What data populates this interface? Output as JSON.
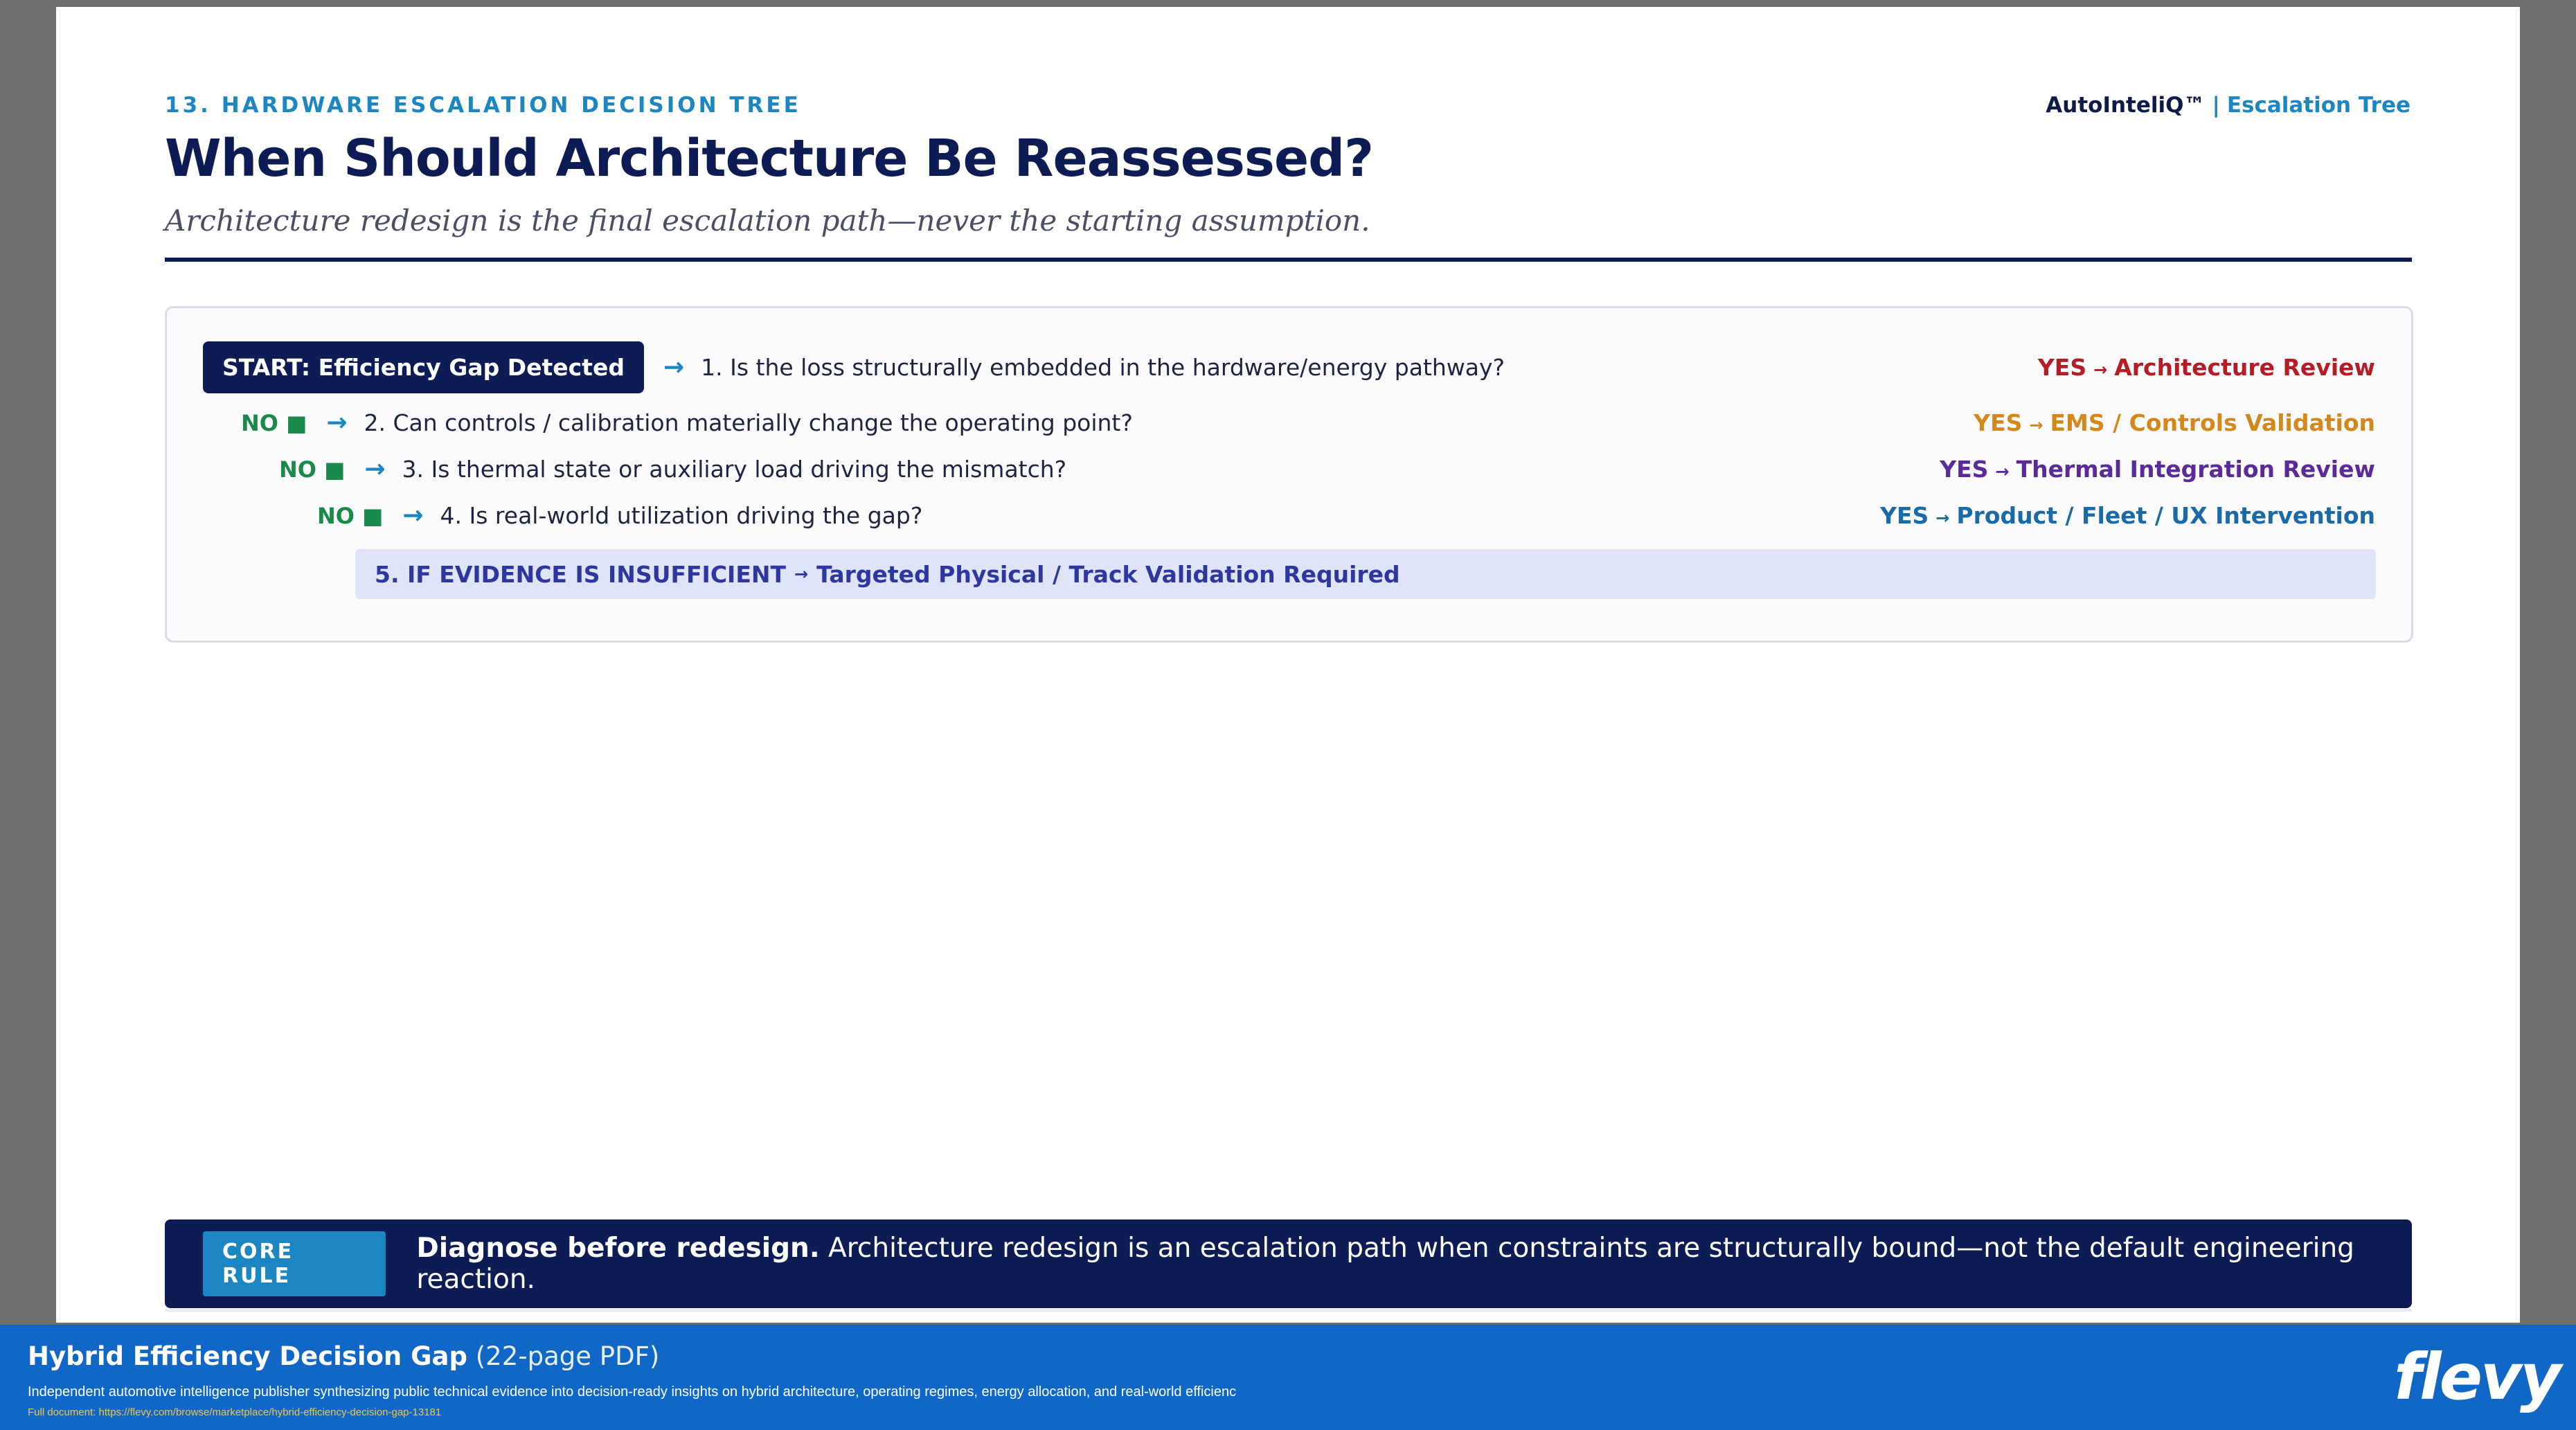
{
  "header": {
    "section_tag": "13. HARDWARE ESCALATION DECISION TREE",
    "brand_name": "AutoInteliQ™",
    "brand_separator": "|",
    "brand_sub": "Escalation Tree",
    "title": "When Should Architecture Be Reassessed?",
    "subtitle": "Architecture redesign is the final escalation path—never the starting assumption."
  },
  "tree": {
    "start_label": "START: Efficiency Gap Detected",
    "arrow_icon": "→",
    "no_label": "NO ■",
    "yes_arrow": "→",
    "steps": [
      {
        "question": "1. Is the loss structurally embedded in the hardware/energy pathway?",
        "yes_word": "YES",
        "yes_outcome": "Architecture Review",
        "color": "#b51c24"
      },
      {
        "question": "2. Can controls / calibration materially change the operating point?",
        "yes_word": "YES",
        "yes_outcome": "EMS / Controls Validation",
        "color": "#d4871a"
      },
      {
        "question": "3. Is thermal state or auxiliary load driving the mismatch?",
        "yes_word": "YES",
        "yes_outcome": "Thermal Integration Review",
        "color": "#5a2a98"
      },
      {
        "question": "4. Is real-world utilization driving the gap?",
        "yes_word": "YES",
        "yes_outcome": "Product / Fleet / UX Intervention",
        "color": "#1a6aa8"
      }
    ],
    "evidence_condition": "5. IF EVIDENCE IS INSUFFICIENT",
    "evidence_arrow": "→",
    "evidence_outcome": "Targeted Physical / Track Validation Required"
  },
  "core_rule": {
    "badge": "CORE RULE",
    "lead": "Diagnose before redesign.",
    "body": "Architecture redesign is an escalation path when constraints are structurally bound—not the default engineering reaction."
  },
  "footer": {
    "doc_title": "Hybrid Efficiency Decision Gap",
    "doc_pages": "(22-page PDF)",
    "description": "Independent automotive intelligence publisher synthesizing public technical evidence into decision-ready insights on hybrid architecture, operating regimes, energy allocation, and real-world efficienc",
    "link_text": "Full document: https://flevy.com/browse/marketplace/hybrid-efficiency-decision-gap-13181",
    "logo_text": "flevy"
  }
}
